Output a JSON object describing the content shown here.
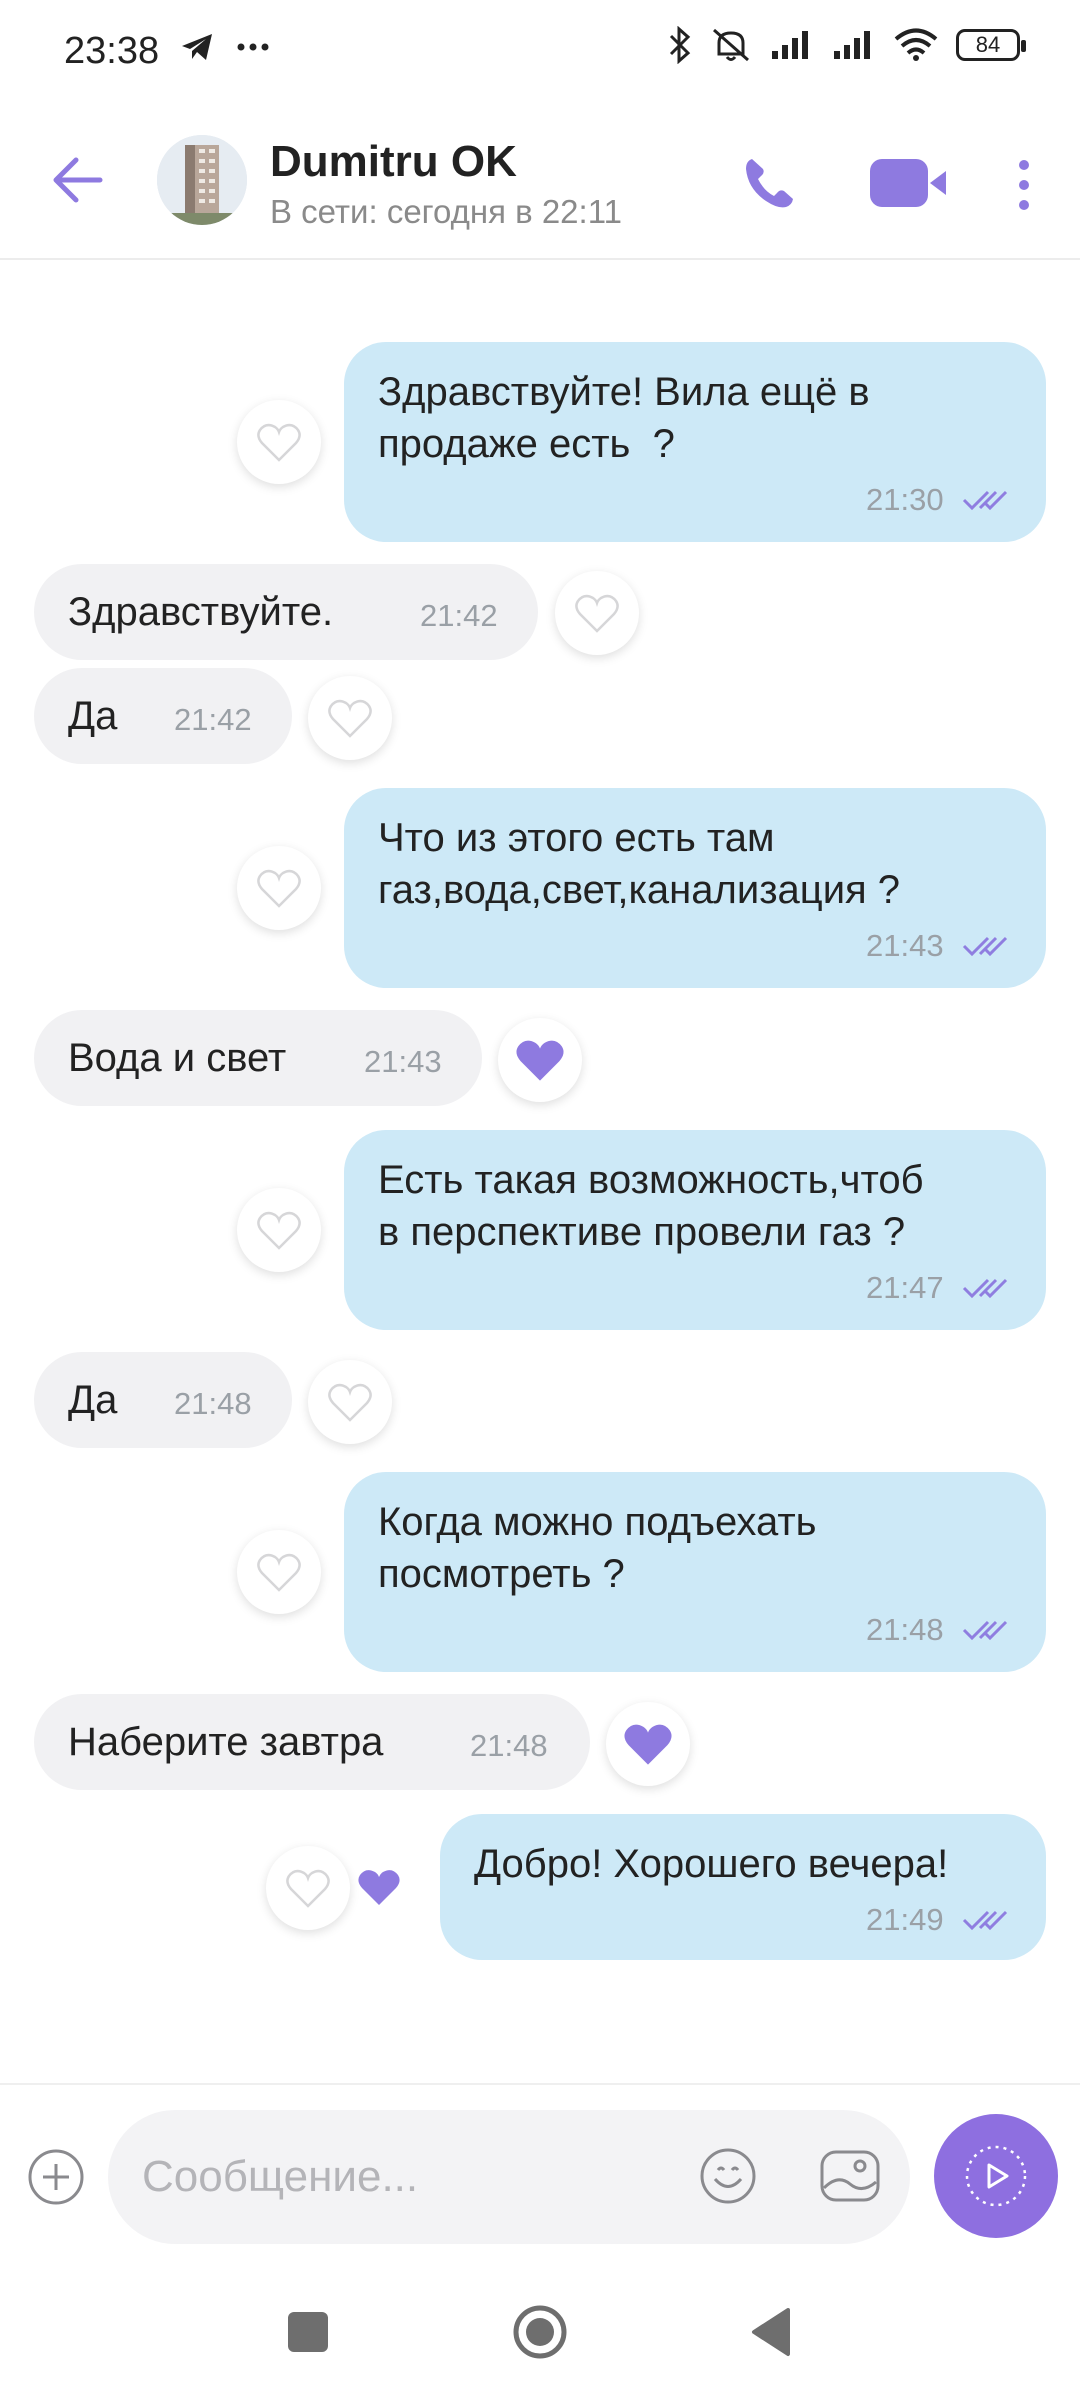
{
  "status_bar": {
    "time": "23:38",
    "battery": "84"
  },
  "header": {
    "name": "Dumitru OK",
    "status": "В сети: сегодня в 22:11"
  },
  "messages": [
    {
      "dir": "out",
      "text": "Здравствуйте! Вила ещё в\nпродаже есть  ?",
      "time": "21:30",
      "liked": false
    },
    {
      "dir": "in",
      "text": "Здравствуйте.",
      "time": "21:42",
      "liked": false
    },
    {
      "dir": "in",
      "text": "Да",
      "time": "21:42",
      "liked": false
    },
    {
      "dir": "out",
      "text": "Что из этого есть там\nгаз,вода,свет,канализация ?",
      "time": "21:43",
      "liked": false
    },
    {
      "dir": "in",
      "text": "Вода и свет",
      "time": "21:43",
      "liked": true
    },
    {
      "dir": "out",
      "text": "Есть такая возможность,чтоб\nв перспективе провели газ ?",
      "time": "21:47",
      "liked": false
    },
    {
      "dir": "in",
      "text": "Да",
      "time": "21:48",
      "liked": false
    },
    {
      "dir": "out",
      "text": "Когда можно подъехать\nпосмотреть ?",
      "time": "21:48",
      "liked": false
    },
    {
      "dir": "in",
      "text": "Наберите завтра",
      "time": "21:48",
      "liked": true
    },
    {
      "dir": "out",
      "text": "Добро! Хорошего вечера!",
      "time": "21:49",
      "liked": false,
      "reaction": "heart"
    }
  ],
  "composer": {
    "placeholder": "Сообщение..."
  },
  "colors": {
    "accent": "#8e6fe0",
    "outgoing_bubble": "#cde9f7",
    "incoming_bubble": "#f1f1f3",
    "read_ticks": "#8f7ee0"
  }
}
